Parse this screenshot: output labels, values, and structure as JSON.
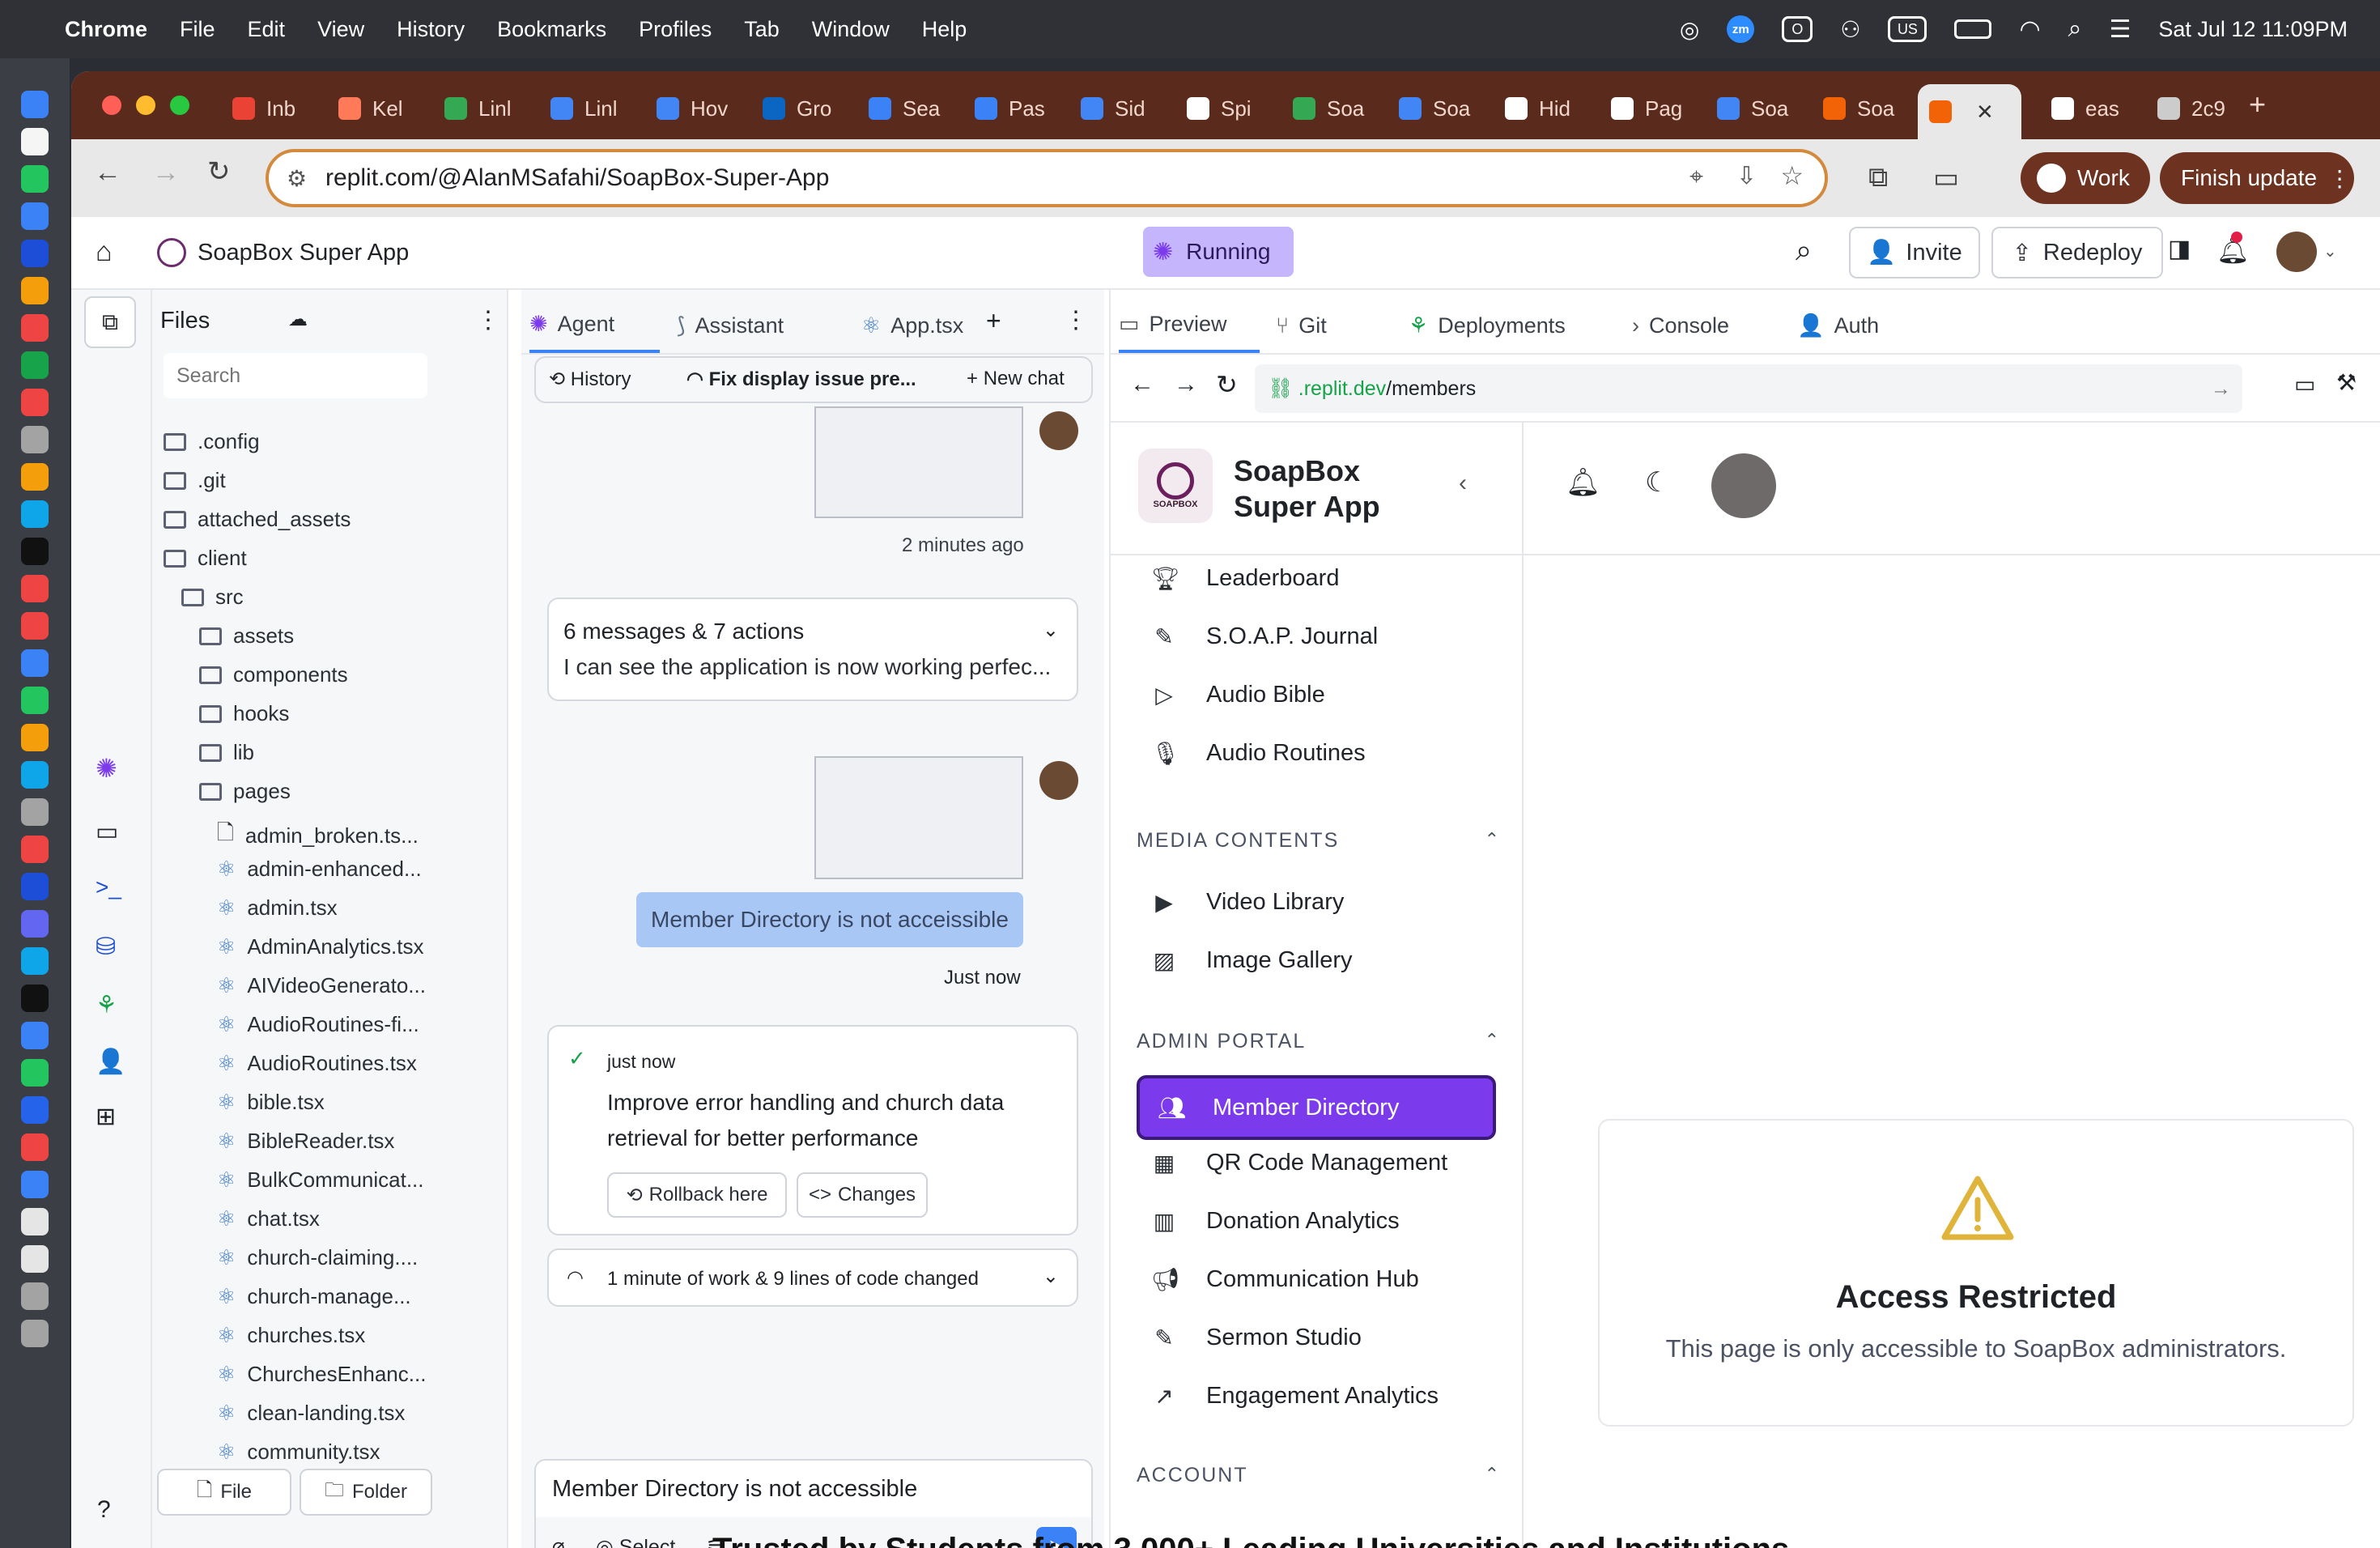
{
  "menubar": {
    "app": "Chrome",
    "items": [
      "File",
      "Edit",
      "View",
      "History",
      "Bookmarks",
      "Profiles",
      "Tab",
      "Window",
      "Help"
    ],
    "clock": "Sat Jul 12  11:09PM",
    "input_source": "US",
    "zoom_badge": "zm"
  },
  "browser": {
    "tabs": [
      {
        "label": "Inb",
        "icon": "gmail-icon",
        "color": "#ea4335"
      },
      {
        "label": "Kel",
        "icon": "hubspot-icon",
        "color": "#ff7a59"
      },
      {
        "label": "Linl",
        "icon": "sheets-icon",
        "color": "#34a853"
      },
      {
        "label": "Linl",
        "icon": "docs-icon",
        "color": "#4285f4"
      },
      {
        "label": "Hov",
        "icon": "docs-icon",
        "color": "#4285f4"
      },
      {
        "label": "Gro",
        "icon": "linkedin-icon",
        "color": "#0a66c2"
      },
      {
        "label": "Sea",
        "icon": "compass-icon",
        "color": "#3b82f6"
      },
      {
        "label": "Pas",
        "icon": "compass-icon",
        "color": "#3b82f6"
      },
      {
        "label": "Sid",
        "icon": "docs-icon",
        "color": "#4285f4"
      },
      {
        "label": "Spi",
        "icon": "chat-icon",
        "color": "#ffffff"
      },
      {
        "label": "Soa",
        "icon": "sheets-icon",
        "color": "#34a853"
      },
      {
        "label": "Soa",
        "icon": "docs-icon",
        "color": "#4285f4"
      },
      {
        "label": "Hid",
        "icon": "openai-icon",
        "color": "#ffffff"
      },
      {
        "label": "Pag",
        "icon": "github-icon",
        "color": "#ffffff"
      },
      {
        "label": "Soa",
        "icon": "docs-icon",
        "color": "#4285f4"
      },
      {
        "label": "Soa",
        "icon": "replit-icon",
        "color": "#f26207"
      },
      {
        "label": "",
        "icon": "replit-icon",
        "color": "#f26207",
        "active": true
      },
      {
        "label": "eas",
        "icon": "google-icon",
        "color": "#ffffff"
      },
      {
        "label": "2c9",
        "icon": "globe-icon",
        "color": "#cccccc"
      }
    ],
    "url": "replit.com/@AlanMSafahi/SoapBox-Super-App",
    "profile": "Work",
    "finish_update": "Finish update"
  },
  "replit": {
    "project_title": "SoapBox Super App",
    "running": "Running",
    "invite": "Invite",
    "redeploy": "Redeploy",
    "files": {
      "title": "Files",
      "search_placeholder": "Search",
      "tree": [
        {
          "name": ".config",
          "type": "folder",
          "depth": 0
        },
        {
          "name": ".git",
          "type": "folder",
          "depth": 0
        },
        {
          "name": "attached_assets",
          "type": "folder",
          "depth": 0
        },
        {
          "name": "client",
          "type": "folder",
          "depth": 0
        },
        {
          "name": "src",
          "type": "folder",
          "depth": 1
        },
        {
          "name": "assets",
          "type": "folder",
          "depth": 2
        },
        {
          "name": "components",
          "type": "folder",
          "depth": 2
        },
        {
          "name": "hooks",
          "type": "folder",
          "depth": 2
        },
        {
          "name": "lib",
          "type": "folder",
          "depth": 2
        },
        {
          "name": "pages",
          "type": "folder",
          "depth": 2
        },
        {
          "name": "admin_broken.ts...",
          "type": "file",
          "depth": 3
        },
        {
          "name": "admin-enhanced...",
          "type": "react",
          "depth": 3
        },
        {
          "name": "admin.tsx",
          "type": "react",
          "depth": 3
        },
        {
          "name": "AdminAnalytics.tsx",
          "type": "react",
          "depth": 3
        },
        {
          "name": "AIVideoGenerato...",
          "type": "react",
          "depth": 3
        },
        {
          "name": "AudioRoutines-fi...",
          "type": "react",
          "depth": 3
        },
        {
          "name": "AudioRoutines.tsx",
          "type": "react",
          "depth": 3
        },
        {
          "name": "bible.tsx",
          "type": "react",
          "depth": 3
        },
        {
          "name": "BibleReader.tsx",
          "type": "react",
          "depth": 3
        },
        {
          "name": "BulkCommunicat...",
          "type": "react",
          "depth": 3
        },
        {
          "name": "chat.tsx",
          "type": "react",
          "depth": 3
        },
        {
          "name": "church-claiming....",
          "type": "react",
          "depth": 3
        },
        {
          "name": "church-manage...",
          "type": "react",
          "depth": 3
        },
        {
          "name": "churches.tsx",
          "type": "react",
          "depth": 3
        },
        {
          "name": "ChurchesEnhanc...",
          "type": "react",
          "depth": 3
        },
        {
          "name": "clean-landing.tsx",
          "type": "react",
          "depth": 3
        },
        {
          "name": "community.tsx",
          "type": "react",
          "depth": 3
        }
      ],
      "new_file": "File",
      "new_folder": "Folder"
    },
    "agent": {
      "tabs": [
        "Agent",
        "Assistant",
        "App.tsx"
      ],
      "history": "History",
      "current_chat": "Fix display issue pre...",
      "new_chat": "New chat",
      "time1": "2 minutes ago",
      "summary_title": "6 messages & 7 actions",
      "summary_text": "I can see the application is now working perfec...",
      "user_message": "Member Directory is not acceissible",
      "time2": "Just now",
      "checkpoint_time": "just now",
      "checkpoint_text": "Improve error handling and church data retrieval for better performance",
      "rollback": "Rollback here",
      "changes": "Changes",
      "work_summary": "1 minute of work & 9 lines of code changed",
      "input_value": "Member Directory is not accessible",
      "select": "Select"
    },
    "preview": {
      "tabs": [
        "Preview",
        "Git",
        "Deployments",
        "Console",
        "Auth"
      ],
      "url_host": ".replit.dev",
      "url_path": "/members",
      "brand_line1": "SoapBox",
      "brand_line2": "Super App",
      "logo_text": "SOAPBOX",
      "nav_top": [
        {
          "label": "Leaderboard",
          "icon": "trophy-icon"
        },
        {
          "label": "S.O.A.P. Journal",
          "icon": "pen-icon"
        },
        {
          "label": "Audio Bible",
          "icon": "play-icon"
        },
        {
          "label": "Audio Routines",
          "icon": "mic-icon"
        }
      ],
      "section_media": "MEDIA CONTENTS",
      "nav_media": [
        {
          "label": "Video Library",
          "icon": "video-icon"
        },
        {
          "label": "Image Gallery",
          "icon": "image-icon"
        }
      ],
      "section_admin": "ADMIN PORTAL",
      "nav_admin": [
        {
          "label": "Member Directory",
          "icon": "users-icon",
          "active": true
        },
        {
          "label": "QR Code Management",
          "icon": "qr-icon"
        },
        {
          "label": "Donation Analytics",
          "icon": "bar-chart-icon"
        },
        {
          "label": "Communication Hub",
          "icon": "megaphone-icon"
        },
        {
          "label": "Sermon Studio",
          "icon": "pen-icon"
        },
        {
          "label": "Engagement Analytics",
          "icon": "trend-icon"
        }
      ],
      "section_account": "ACCOUNT",
      "access_title": "Access Restricted",
      "access_text": "This page is only accessible to SoapBox administrators."
    },
    "colors": {
      "accent": "#7c3aed",
      "running_bg": "#c4b5fd",
      "warning": "#e0b43a"
    }
  },
  "background_text": "Trusted by Students from 3,000+ Leading Universities and Institutions"
}
